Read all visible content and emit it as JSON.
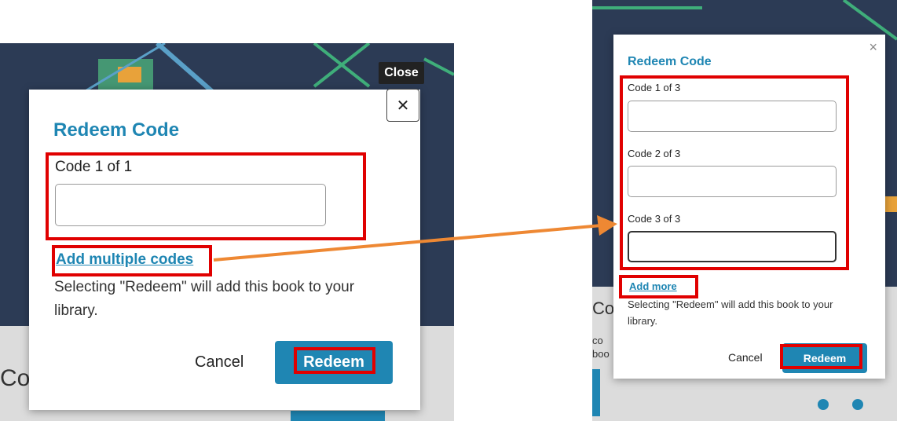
{
  "left_dialog": {
    "title": "Redeem Code",
    "code_label": "Code 1 of 1",
    "code_value": "",
    "add_link": "Add multiple codes",
    "note": "Selecting \"Redeem\" will add this book to your library.",
    "cancel_label": "Cancel",
    "redeem_label": "Redeem",
    "close_tooltip": "Close",
    "close_glyph": "✕"
  },
  "right_dialog": {
    "title": "Redeem Code",
    "codes": [
      {
        "label": "Code 1 of 3",
        "value": ""
      },
      {
        "label": "Code 2 of 3",
        "value": ""
      },
      {
        "label": "Code 3 of 3",
        "value": ""
      }
    ],
    "add_link": "Add more",
    "note": "Selecting \"Redeem\" will add this book to your library.",
    "cancel_label": "Cancel",
    "redeem_label": "Redeem",
    "close_glyph": "×"
  },
  "background_fragments": {
    "left_heading": "Co",
    "right_heading": "Co",
    "right_line1": "co",
    "right_line2": "boo"
  },
  "colors": {
    "highlight": "#e00000",
    "arrow": "#ee8833",
    "accent": "#1f86b3",
    "backdrop": "#2c3b55"
  }
}
